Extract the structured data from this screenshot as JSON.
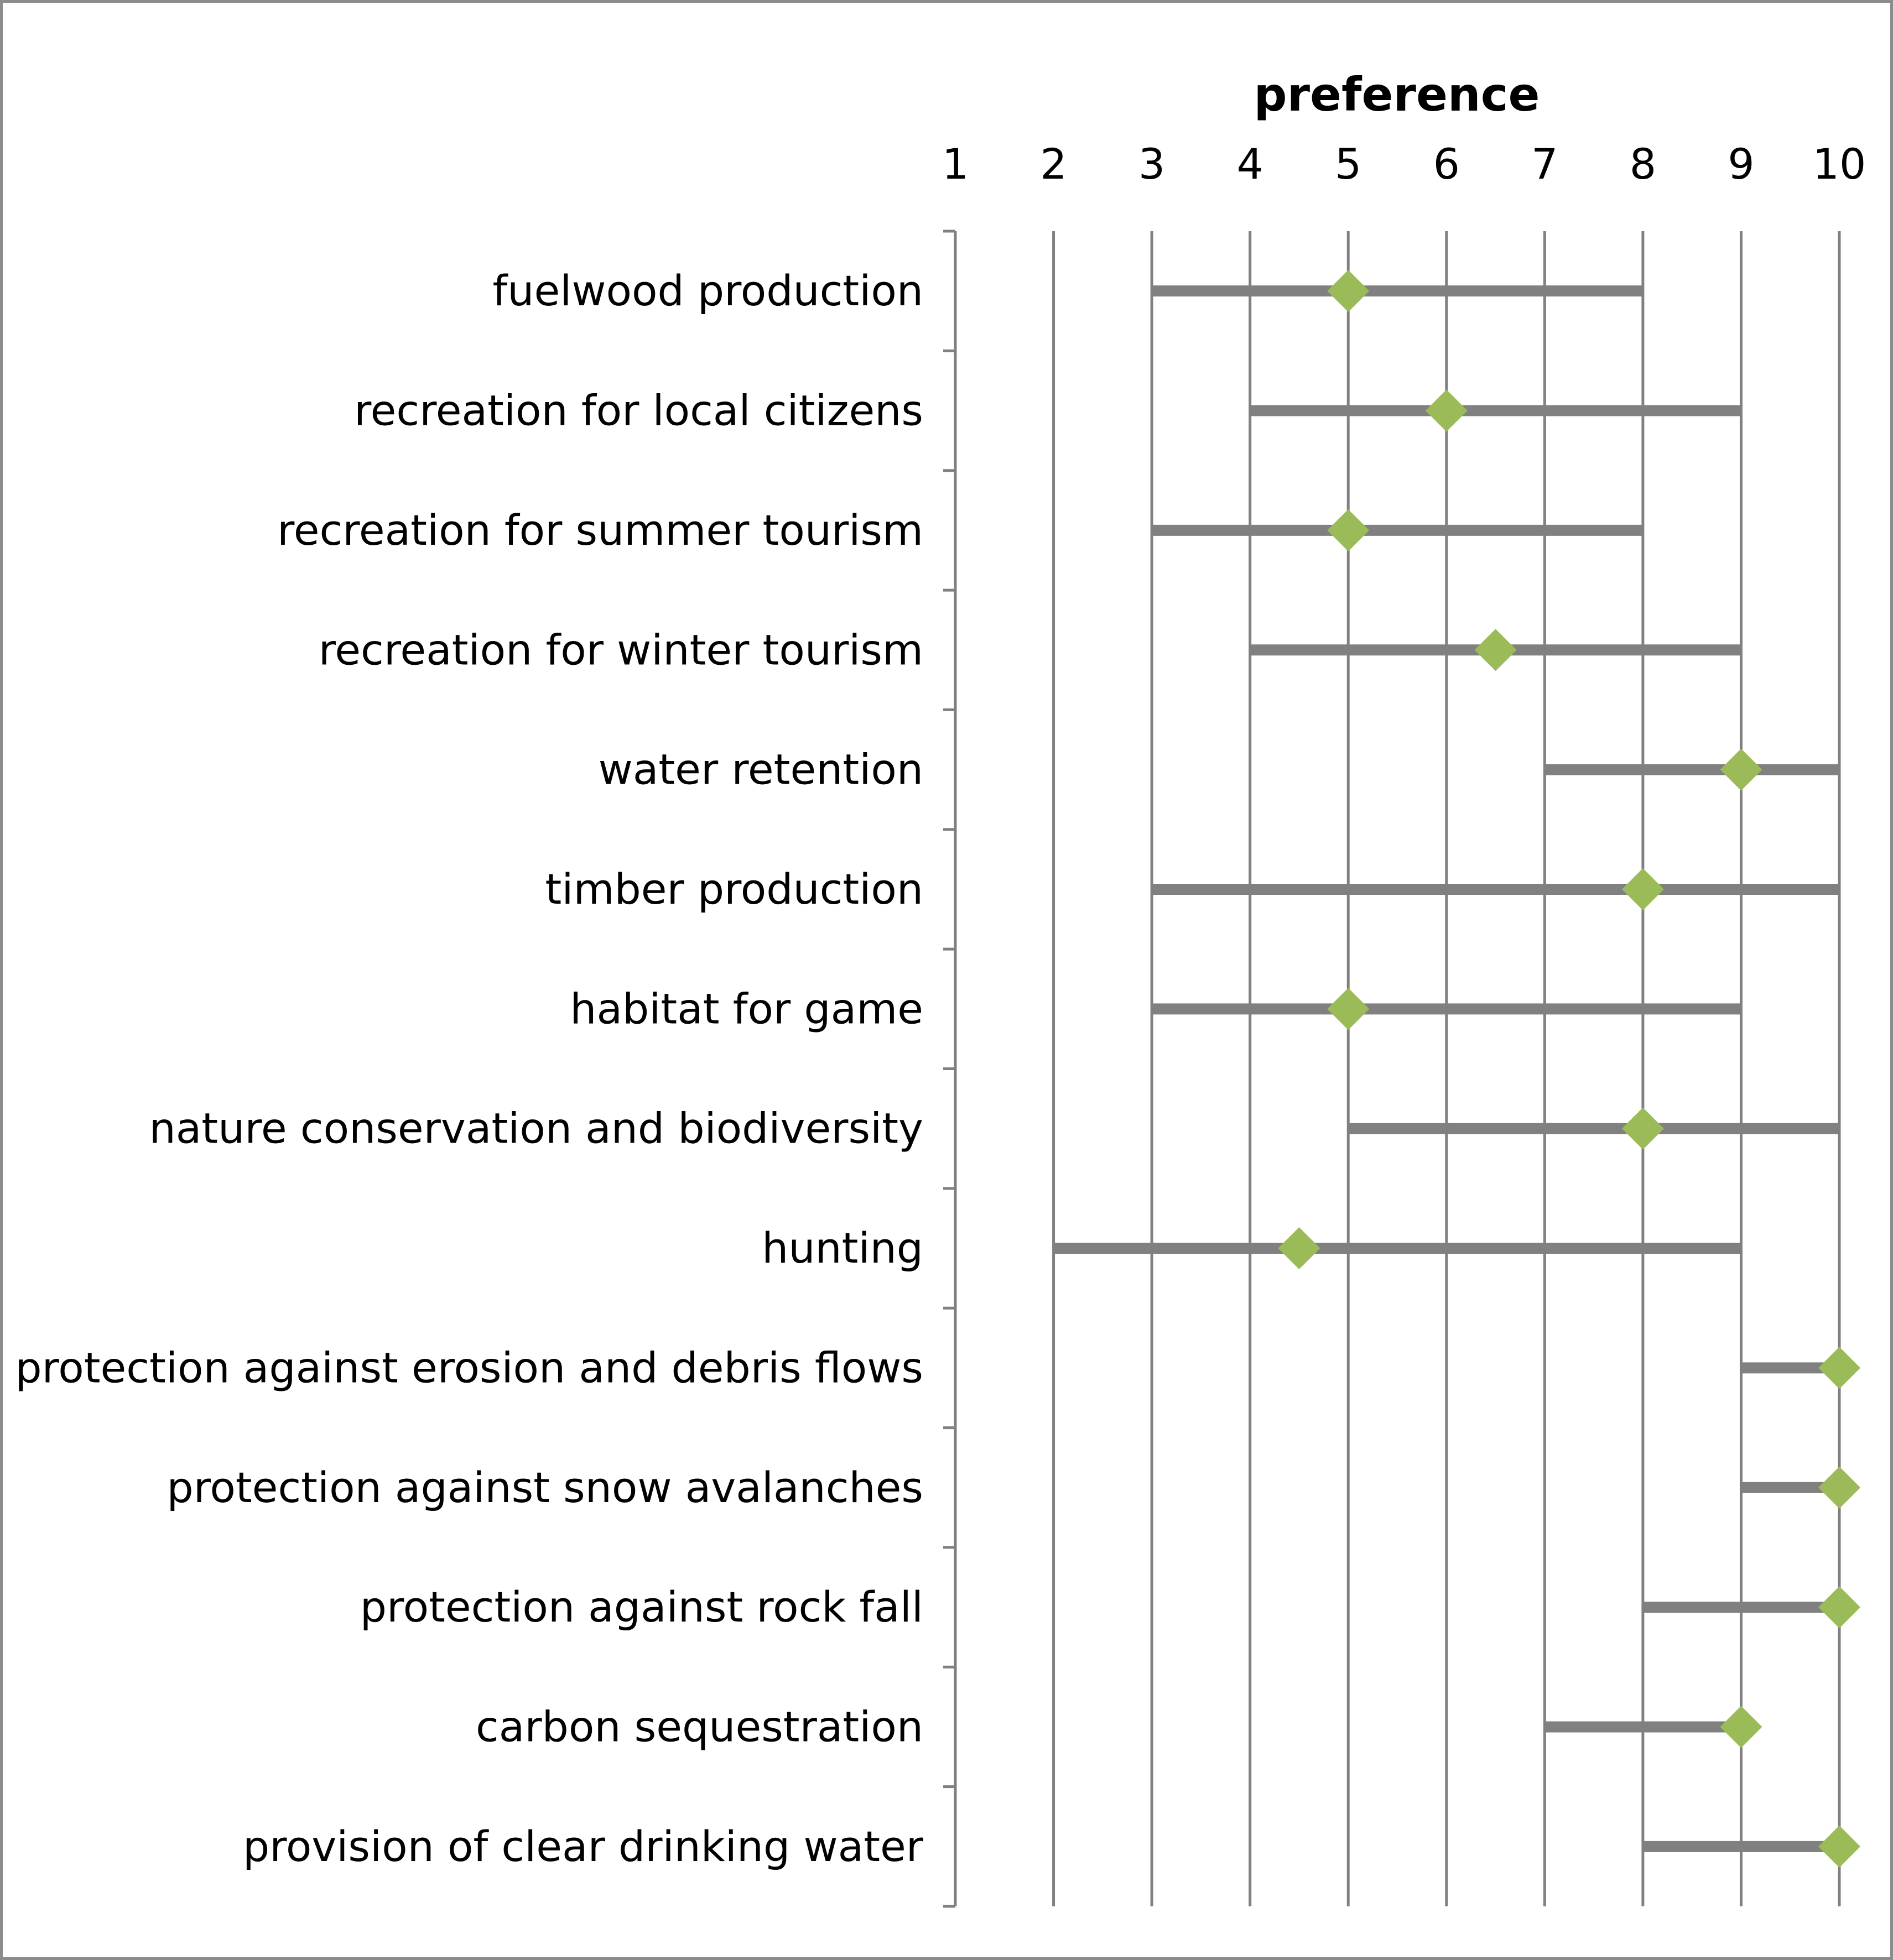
{
  "chart_data": {
    "type": "range-dot",
    "title": "preference",
    "xlabel": "preference",
    "ylabel": "",
    "xlim": [
      1,
      10
    ],
    "xticks": [
      1,
      2,
      3,
      4,
      5,
      6,
      7,
      8,
      9,
      10
    ],
    "grid": true,
    "legend": "none",
    "colors": {
      "range_bar": "#808080",
      "marker": "#9BBB59",
      "grid": "#808080"
    },
    "categories": [
      "fuelwood production",
      "recreation for local citizens",
      "recreation for summer tourism",
      "recreation for winter tourism",
      "water retention",
      "timber production",
      "habitat for game",
      "nature conservation and biodiversity",
      "hunting",
      "protection against erosion and debris flows",
      "protection against snow avalanches",
      "protection against rock fall",
      "carbon sequestration",
      "provision of clear drinking water"
    ],
    "series": [
      {
        "role": "min",
        "values": [
          3,
          4,
          3,
          4,
          7,
          3,
          3,
          5,
          2,
          9,
          9,
          8,
          7,
          8
        ]
      },
      {
        "role": "max",
        "values": [
          8,
          9,
          8,
          9,
          10,
          10,
          9,
          10,
          9,
          10,
          10,
          10,
          9,
          10
        ]
      },
      {
        "role": "median",
        "values": [
          5,
          6,
          5,
          6.5,
          9,
          8,
          5,
          8,
          4.5,
          10,
          10,
          10,
          9,
          10
        ]
      }
    ]
  }
}
